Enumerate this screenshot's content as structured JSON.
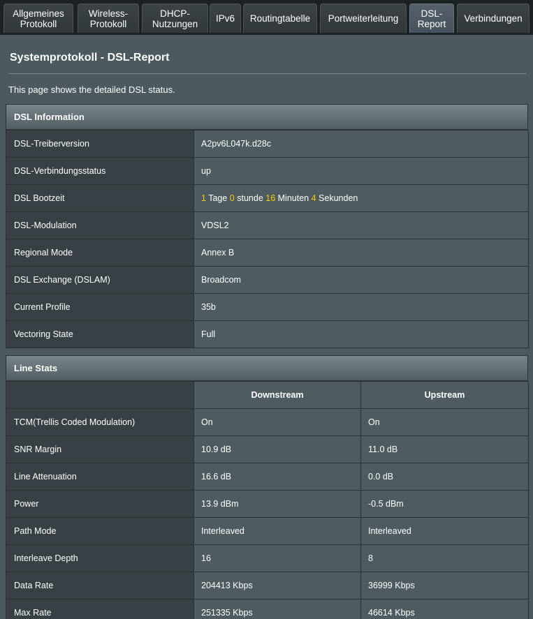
{
  "tabs": [
    {
      "label": "Allgemeines\nProtokoll",
      "active": false
    },
    {
      "label": "Wireless-\nProtokoll",
      "active": false
    },
    {
      "label": "DHCP-\nNutzungen",
      "active": false
    },
    {
      "label": "IPv6",
      "active": false
    },
    {
      "label": "Routingtabelle",
      "active": false
    },
    {
      "label": "Portweiterleitung",
      "active": false
    },
    {
      "label": "DSL-\nReport",
      "active": true
    },
    {
      "label": "Verbindungen",
      "active": false
    }
  ],
  "page": {
    "title": "Systemprotokoll - DSL-Report",
    "description": "This page shows the detailed DSL status."
  },
  "dsl_info": {
    "header": "DSL Information",
    "rows": [
      {
        "label": "DSL-Treiberversion",
        "value": "A2pv6L047k.d28c"
      },
      {
        "label": "DSL-Verbindungsstatus",
        "value": "up"
      },
      {
        "label": "DSL Bootzeit",
        "uptime": {
          "days": "1",
          "days_unit": "Tage",
          "hours": "0",
          "hours_unit": "stunde",
          "minutes": "16",
          "minutes_unit": "Minuten",
          "seconds": "4",
          "seconds_unit": "Sekunden"
        }
      },
      {
        "label": "DSL-Modulation",
        "value": "VDSL2"
      },
      {
        "label": "Regional Mode",
        "value": "Annex B"
      },
      {
        "label": "DSL Exchange (DSLAM)",
        "value": "Broadcom"
      },
      {
        "label": "Current Profile",
        "value": "35b"
      },
      {
        "label": "Vectoring State",
        "value": "Full"
      }
    ]
  },
  "line_stats": {
    "header": "Line Stats",
    "columns": [
      "Downstream",
      "Upstream"
    ],
    "rows": [
      {
        "label": "TCM(Trellis Coded Modulation)",
        "down": "On",
        "up": "On"
      },
      {
        "label": "SNR Margin",
        "down": "10.9 dB",
        "up": "11.0 dB"
      },
      {
        "label": "Line Attenuation",
        "down": "16.6 dB",
        "up": "0.0 dB"
      },
      {
        "label": "Power",
        "down": "13.9 dBm",
        "up": "-0.5 dBm"
      },
      {
        "label": "Path Mode",
        "down": "Interleaved",
        "up": "Interleaved"
      },
      {
        "label": "Interleave Depth",
        "down": "16",
        "up": "8"
      },
      {
        "label": "Data Rate",
        "down": "204413 Kbps",
        "up": "36999 Kbps"
      },
      {
        "label": "Max Rate",
        "down": "251335 Kbps",
        "up": "46614 Kbps"
      }
    ]
  },
  "colors": {
    "highlight": "#ffcc00",
    "label_cell": "#364045",
    "value_cell": "#4e5b60",
    "panel": "#4c595e"
  }
}
